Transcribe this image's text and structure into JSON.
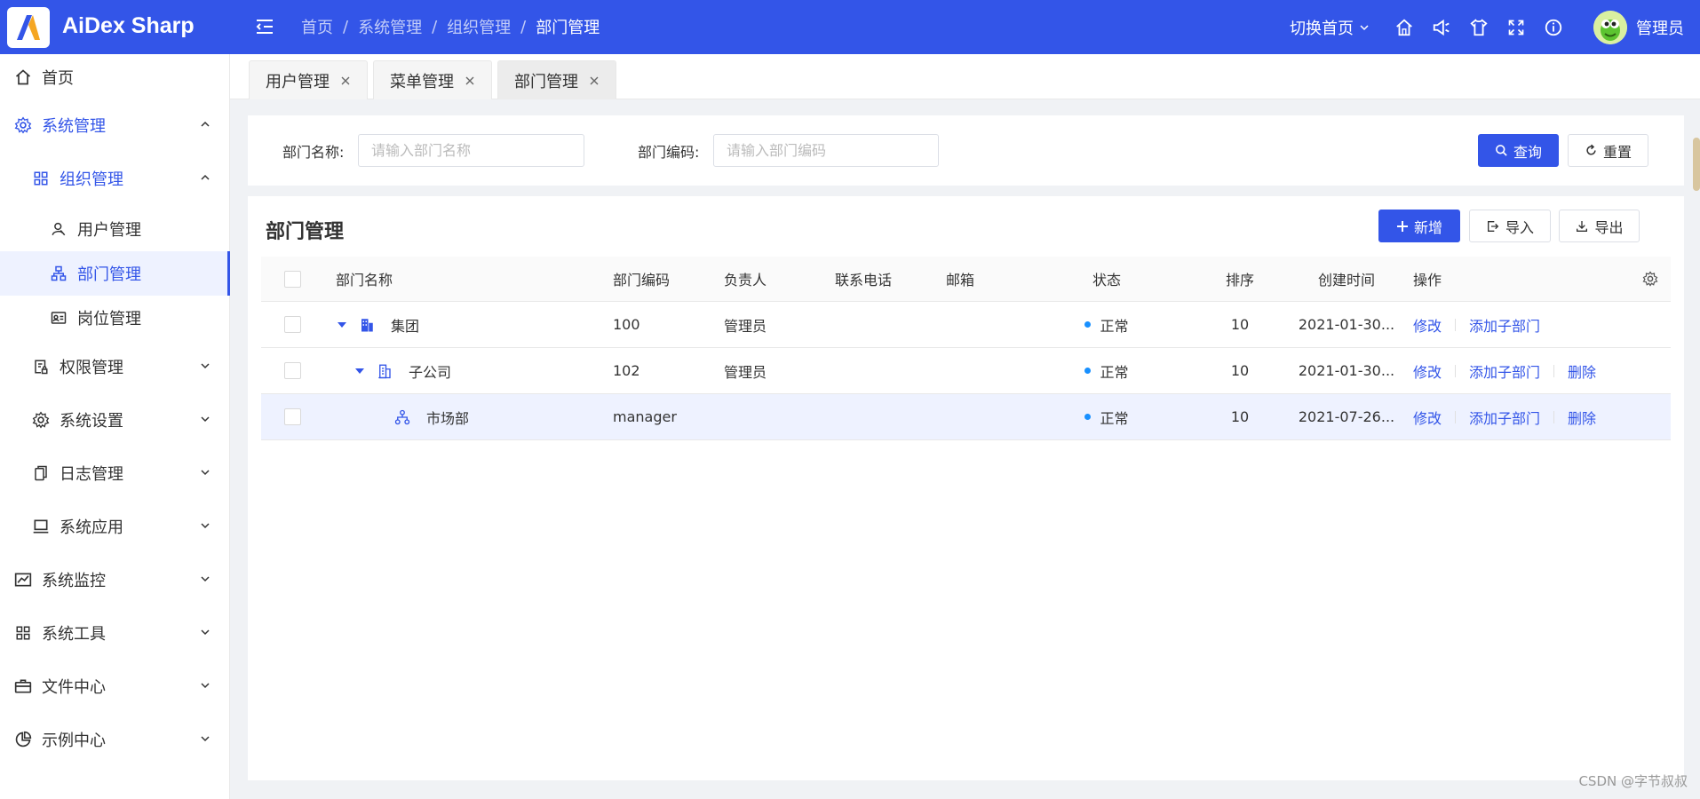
{
  "app": {
    "name": "AiDex Sharp"
  },
  "breadcrumb": [
    "首页",
    "系统管理",
    "组织管理",
    "部门管理"
  ],
  "header": {
    "switch_home": "切换首页",
    "username": "管理员"
  },
  "sidebar": {
    "home": "首页",
    "system": "系统管理",
    "org": "组织管理",
    "user": "用户管理",
    "dept": "部门管理",
    "post": "岗位管理",
    "perm": "权限管理",
    "settings": "系统设置",
    "logs": "日志管理",
    "apps": "系统应用",
    "monitor": "系统监控",
    "tools": "系统工具",
    "files": "文件中心",
    "demo": "示例中心"
  },
  "tabs": [
    "用户管理",
    "菜单管理",
    "部门管理"
  ],
  "search": {
    "name_label": "部门名称:",
    "name_placeholder": "请输入部门名称",
    "code_label": "部门编码:",
    "code_placeholder": "请输入部门编码",
    "query": "查询",
    "reset": "重置"
  },
  "panel": {
    "title": "部门管理",
    "add": "新增",
    "import": "导入",
    "export": "导出"
  },
  "table": {
    "columns": [
      "部门名称",
      "部门编码",
      "负责人",
      "联系电话",
      "邮箱",
      "状态",
      "排序",
      "创建时间",
      "操作"
    ],
    "rows": [
      {
        "name": "集团",
        "code": "100",
        "leader": "管理员",
        "phone": "",
        "email": "",
        "status": "正常",
        "sort": "10",
        "created": "2021-01-30...",
        "actions": [
          "修改",
          "添加子部门"
        ]
      },
      {
        "name": "子公司",
        "code": "102",
        "leader": "管理员",
        "phone": "",
        "email": "",
        "status": "正常",
        "sort": "10",
        "created": "2021-01-30...",
        "actions": [
          "修改",
          "添加子部门",
          "删除"
        ]
      },
      {
        "name": "市场部",
        "code": "manager",
        "leader": "",
        "phone": "",
        "email": "",
        "status": "正常",
        "sort": "10",
        "created": "2021-07-26...",
        "actions": [
          "修改",
          "添加子部门",
          "删除"
        ]
      }
    ]
  },
  "watermark": "CSDN @字节叔叔",
  "colors": {
    "primary": "#3355e8",
    "status_dot": "#1890ff"
  }
}
